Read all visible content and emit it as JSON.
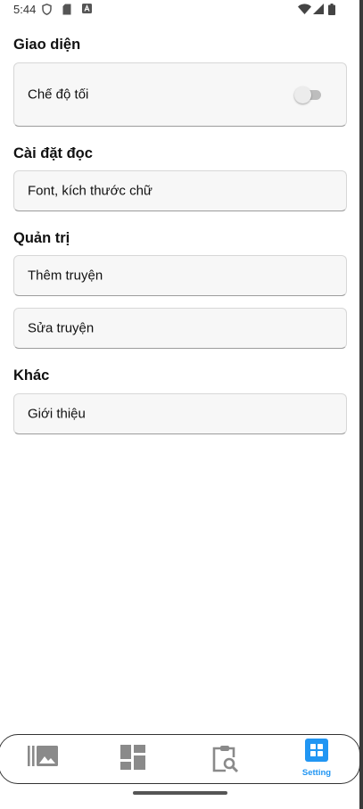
{
  "status_bar": {
    "time": "5:44"
  },
  "sections": [
    {
      "title": "Giao diện",
      "items": [
        {
          "label": "Chế độ tối",
          "toggle": false
        }
      ]
    },
    {
      "title": "Cài đặt đọc",
      "items": [
        {
          "label": "Font, kích thước chữ"
        }
      ]
    },
    {
      "title": "Quản trị",
      "items": [
        {
          "label": "Thêm truyện"
        },
        {
          "label": "Sửa truyện"
        }
      ]
    },
    {
      "title": "Khác",
      "items": [
        {
          "label": "Giới thiệu"
        }
      ]
    }
  ],
  "bottom_nav": {
    "items": [
      {
        "icon": "library-icon",
        "label": ""
      },
      {
        "icon": "dashboard-icon",
        "label": ""
      },
      {
        "icon": "search-clipboard-icon",
        "label": ""
      },
      {
        "icon": "grid-icon",
        "label": "Setting",
        "active": true
      }
    ]
  },
  "colors": {
    "accent": "#2196f3",
    "card_bg": "#f7f7f7",
    "icon_inactive": "#8a8a8a"
  }
}
